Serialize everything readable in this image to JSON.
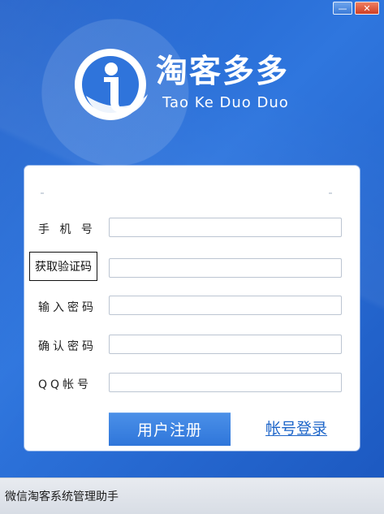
{
  "window": {
    "minimize_label": "—",
    "close_label": "✕"
  },
  "brand": {
    "name_cn": "淘客多多",
    "name_en": "Tao Ke Duo Duo",
    "logo_icon": "brand-logo-icon",
    "accent_color": "#2f76de"
  },
  "form": {
    "phone_label": "手 机 号",
    "sms_code_button": "获取验证码",
    "password_label": "输入密码",
    "confirm_password_label": "确认密码",
    "qq_label": "QQ帐号",
    "phone_value": "",
    "sms_code_value": "",
    "password_value": "",
    "confirm_password_value": "",
    "qq_value": "",
    "register_button": "用户注册",
    "login_link": "帐号登录"
  },
  "status": {
    "text": "微信淘客系统管理助手"
  }
}
